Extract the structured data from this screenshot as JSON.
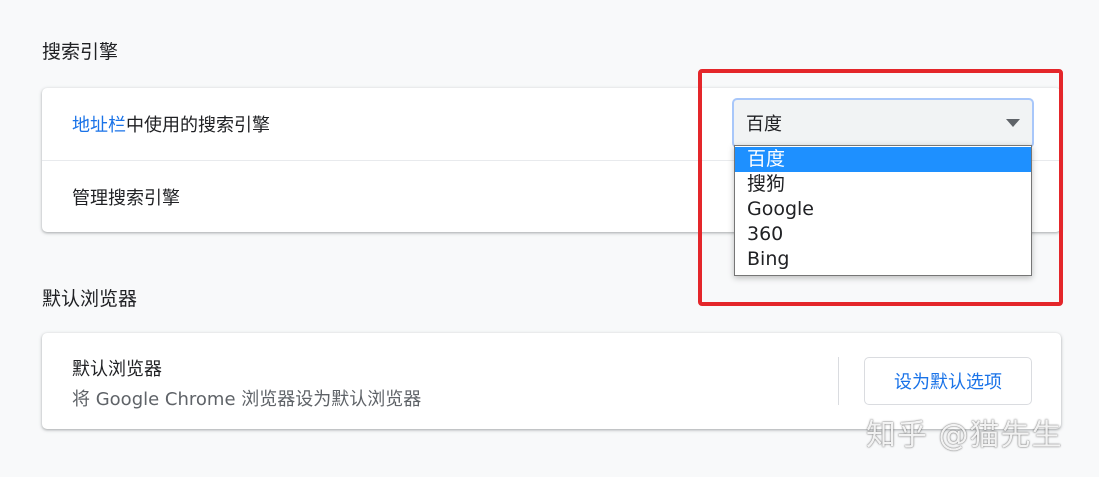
{
  "search_section": {
    "title": "搜索引擎",
    "address_bar_row": {
      "link_text": "地址栏",
      "rest_text": "中使用的搜索引擎",
      "select_value": "百度"
    },
    "manage_row_label": "管理搜索引擎",
    "dropdown_options": [
      {
        "label": "百度",
        "selected": true
      },
      {
        "label": "搜狗",
        "selected": false
      },
      {
        "label": "Google",
        "selected": false
      },
      {
        "label": "360",
        "selected": false
      },
      {
        "label": "Bing",
        "selected": false
      }
    ]
  },
  "browser_section": {
    "title": "默认浏览器",
    "card_title": "默认浏览器",
    "card_desc": "将 Google Chrome 浏览器设为默认浏览器",
    "button_label": "设为默认选项"
  },
  "watermark": "知乎 @猫先生",
  "colors": {
    "link": "#1a73e8",
    "highlight": "#e4262a",
    "selected_option": "#1e90ff"
  }
}
